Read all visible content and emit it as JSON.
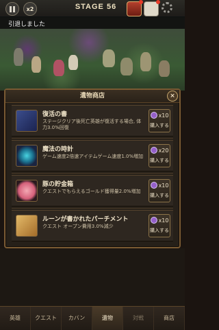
{
  "hud": {
    "speed": "x2",
    "stage": "STAGE 56",
    "chat": "引退しました"
  },
  "shop": {
    "title": "遺物商店",
    "close": "×",
    "items": [
      {
        "name": "復活の書",
        "desc": "ステージクリア後死亡英雄が復活する場合, 体力3.0%回復",
        "qty": "x10",
        "buy": "購入する",
        "icon": "book-icon"
      },
      {
        "name": "魔法の時計",
        "desc": "ゲーム速度2倍速アイテムゲーム速度1.0%増加",
        "qty": "x20",
        "buy": "購入する",
        "icon": "clock-icon"
      },
      {
        "name": "豚の貯金箱",
        "desc": "クエストでもらえるゴールド獲得量2.0%増加",
        "qty": "x10",
        "buy": "購入する",
        "icon": "piggy-bank-icon"
      },
      {
        "name": "ルーンが書かれたパーチメント",
        "desc": "クエスト オープン費用3.0%減少",
        "qty": "x10",
        "buy": "購入する",
        "icon": "parchment-icon"
      }
    ]
  },
  "nav": {
    "items": [
      "英雄",
      "クエスト",
      "カバン",
      "遺物",
      "対戦",
      "商店"
    ],
    "active": 3
  },
  "colors": {
    "accent": "#7a5a33",
    "ticket": "#9460c9"
  }
}
